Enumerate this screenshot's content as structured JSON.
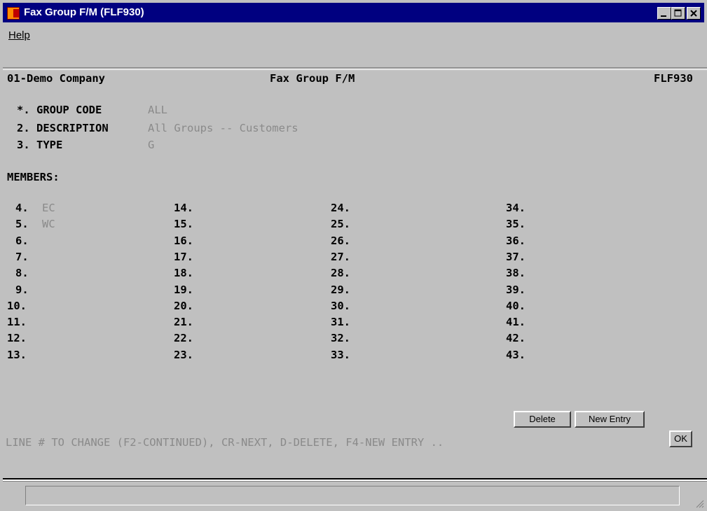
{
  "window": {
    "title": "Fax Group F/M (FLF930)"
  },
  "menu": {
    "help_label": "Help"
  },
  "header": {
    "company": "01-Demo Company",
    "screen_title": "Fax Group F/M",
    "program_code": "FLF930"
  },
  "fields": {
    "group_code_label": "*. GROUP CODE",
    "group_code_value": "ALL",
    "description_label": "2. DESCRIPTION",
    "description_value": "All Groups -- Customers",
    "type_label": "3. TYPE",
    "type_value": "G"
  },
  "members_heading": "MEMBERS:",
  "members": {
    "col1": [
      {
        "num": "4.",
        "value": "EC"
      },
      {
        "num": "5.",
        "value": "WC"
      },
      {
        "num": "6.",
        "value": ""
      },
      {
        "num": "7.",
        "value": ""
      },
      {
        "num": "8.",
        "value": ""
      },
      {
        "num": "9.",
        "value": ""
      },
      {
        "num": "10.",
        "value": ""
      },
      {
        "num": "11.",
        "value": ""
      },
      {
        "num": "12.",
        "value": ""
      },
      {
        "num": "13.",
        "value": ""
      }
    ],
    "col2": [
      "14.",
      "15.",
      "16.",
      "17.",
      "18.",
      "19.",
      "20.",
      "21.",
      "22.",
      "23."
    ],
    "col3": [
      "24.",
      "25.",
      "26.",
      "27.",
      "28.",
      "29.",
      "30.",
      "31.",
      "32.",
      "33."
    ],
    "col4": [
      "34.",
      "35.",
      "36.",
      "37.",
      "38.",
      "39.",
      "40.",
      "41.",
      "42.",
      "43."
    ]
  },
  "buttons": {
    "delete": "Delete",
    "new_entry": "New Entry",
    "ok": "OK"
  },
  "prompt": "LINE # TO CHANGE (F2-CONTINUED), CR-NEXT, D-DELETE, F4-NEW ENTRY ..",
  "status_text": "",
  "colors": {
    "title_bar": "#000080",
    "window_bg": "#c0c0c0",
    "field_value": "#8a8a8a"
  }
}
